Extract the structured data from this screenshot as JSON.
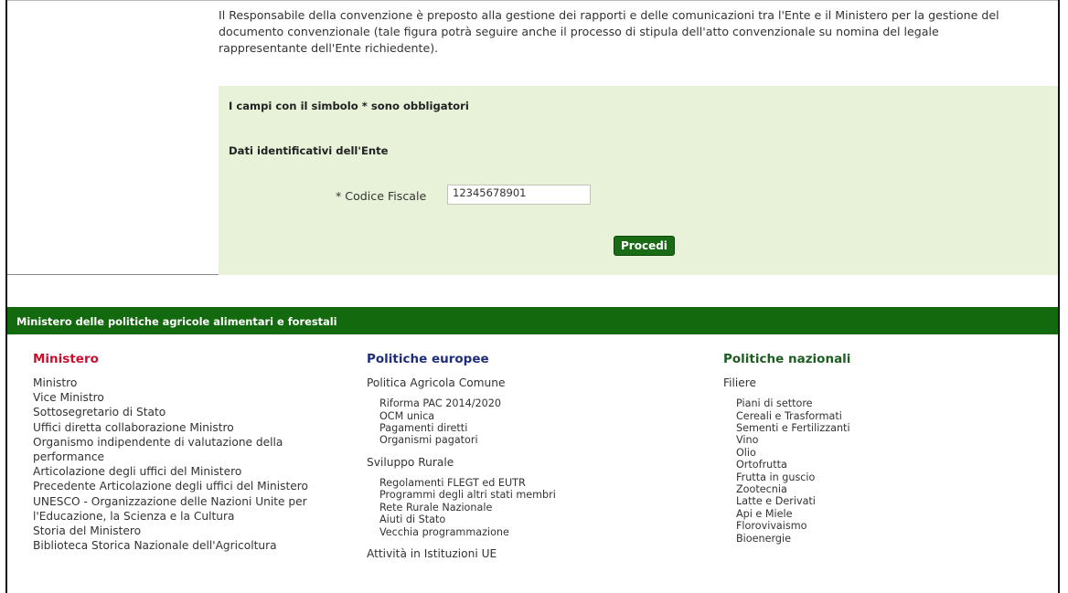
{
  "intro_text": "Il Responsabile della convenzione è preposto alla gestione dei rapporti e delle comunicazioni tra l'Ente e il Ministero per la gestione del documento convenzionale (tale figura potrà seguire anche il processo di stipula dell'atto convenzionale su nomina del legale rappresentante dell'Ente richiedente).",
  "form": {
    "required_note": "I campi con il simbolo * sono obbligatori",
    "section_title": "Dati identificativi dell'Ente",
    "codice_fiscale_label": "* Codice Fiscale",
    "codice_fiscale_value": "12345678901",
    "submit_label": "Procedi"
  },
  "footer": {
    "title": "Ministero delle politiche agricole alimentari e forestali",
    "ministero": {
      "heading": "Ministero",
      "items": [
        "Ministro",
        "Vice Ministro",
        "Sottosegretario di Stato",
        "Uffici diretta collaborazione Ministro",
        "Organismo indipendente di valutazione della performance",
        "Articolazione degli uffici del Ministero",
        "Precedente Articolazione degli uffici del Ministero",
        "UNESCO - Organizzazione delle Nazioni Unite per l'Educazione, la Scienza e la Cultura",
        "Storia del Ministero",
        "Biblioteca Storica Nazionale dell'Agricoltura"
      ]
    },
    "politiche_europee": {
      "heading": "Politiche europee",
      "group1": "Politica Agricola Comune",
      "group1_items": [
        "Riforma PAC 2014/2020",
        "OCM unica",
        "Pagamenti diretti",
        "Organismi pagatori"
      ],
      "group2": "Sviluppo Rurale",
      "group2_items": [
        "Regolamenti FLEGT ed EUTR",
        "Programmi degli altri stati membri",
        "Rete Rurale Nazionale",
        "Aiuti di Stato",
        "Vecchia programmazione"
      ],
      "group3": "Attività in Istituzioni UE"
    },
    "politiche_nazionali": {
      "heading": "Politiche nazionali",
      "group1": "Filiere",
      "group1_items": [
        "Piani di settore",
        "Cereali e Trasformati",
        "Sementi e Fertilizzanti",
        "Vino",
        "Olio",
        "Ortofrutta",
        "Frutta in guscio",
        "Zootecnia",
        "Latte e Derivati",
        "Api e Miele",
        "Florovivaismo",
        "Bioenergie"
      ]
    }
  }
}
